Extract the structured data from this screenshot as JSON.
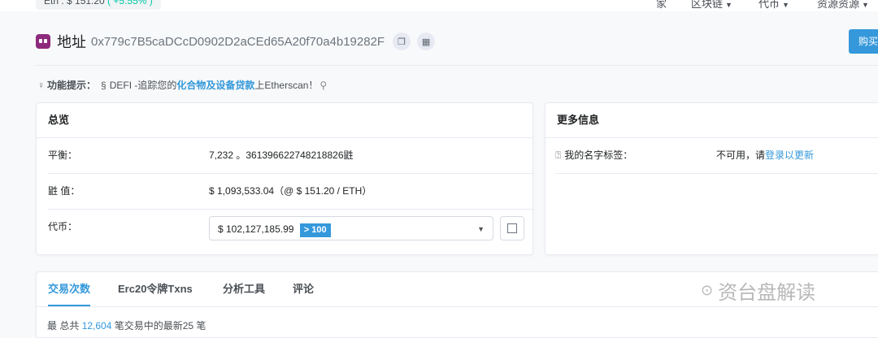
{
  "topbar": {
    "eth_price": "Eth : $ 151.20",
    "eth_change": "( +5.55% )",
    "nav": [
      {
        "label": "家"
      },
      {
        "label": "区块链",
        "has_caret": true
      },
      {
        "label": "代币",
        "has_caret": true
      },
      {
        "label": "资源资源",
        "has_caret": true
      }
    ]
  },
  "header": {
    "label": "地址",
    "address": "0x779c7B5caDCcD0902D2aCEd65A20f70a4b19282F",
    "buy_label": "购买"
  },
  "tip": {
    "prefix": "功能提示：",
    "text1": "DEFI -追踪您的",
    "link": "化合物及设备贷款",
    "text2": "上Etherscan！"
  },
  "overview": {
    "title": "总览",
    "balance_label": "平衡：",
    "balance_value": "7,232 。361396622748218826鼪",
    "value_label": "鼪 值：",
    "value_value": "$ 1,093,533.04（@ $ 151.20 / ETH）",
    "token_label": "代币：",
    "token_value": "$ 102,127,185.99",
    "token_badge": "> 100"
  },
  "more_info": {
    "title": "更多信息",
    "name_tag_label": "我的名字标签：",
    "name_tag_text": "不可用，请",
    "name_tag_link": "登录以更新"
  },
  "tabs": [
    {
      "label": "交易次数",
      "active": true
    },
    {
      "label": "Erc20令牌Txns"
    },
    {
      "label": "分析工具"
    },
    {
      "label": "评论"
    }
  ],
  "watermark": "资台盘解读",
  "peek": {
    "text1": "最 总共",
    "link": "12,604",
    "text2": "笔交易中的最新25 笔"
  },
  "colors": {
    "accent": "#3498db",
    "positive": "#00c9a7",
    "title_icon": "#8e2a7b"
  }
}
